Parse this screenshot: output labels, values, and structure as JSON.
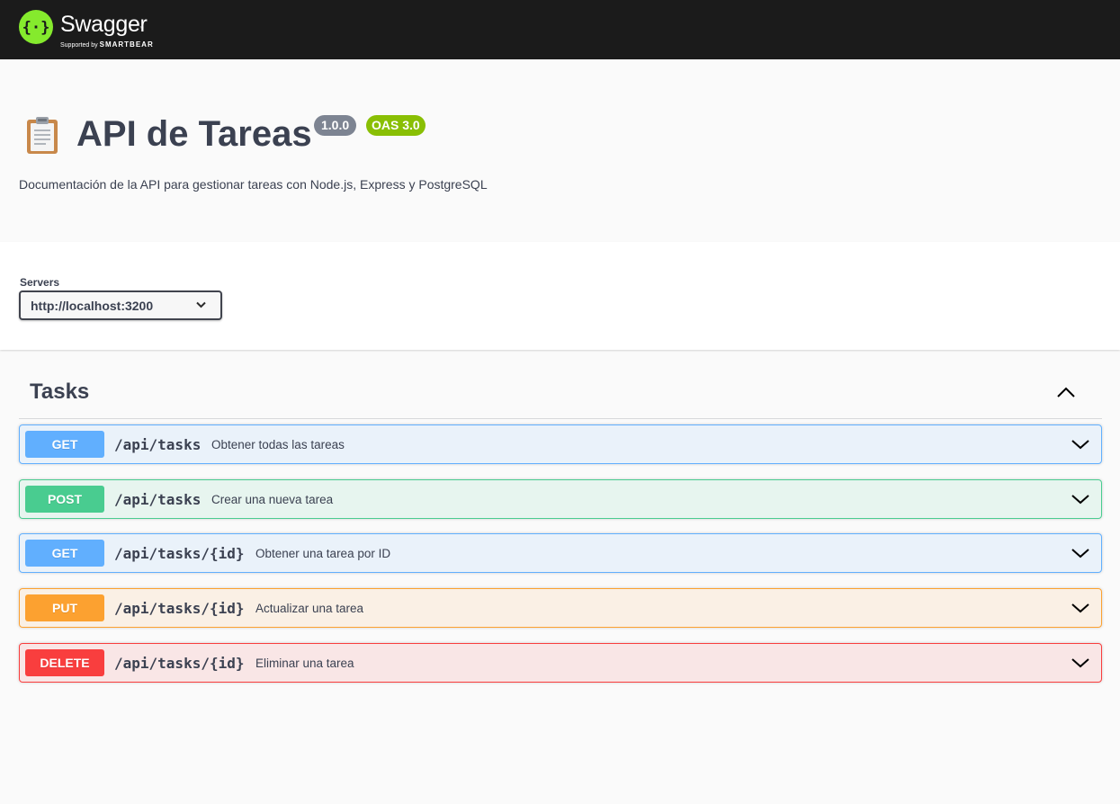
{
  "topbar": {
    "brand_name": "Swagger",
    "brand_tm": "™",
    "supported_prefix": "Supported by",
    "supported_company": "SMARTBEAR",
    "logo_icon": "swagger-braces-icon",
    "colors": {
      "background": "#1b1b1b",
      "logo": "#85ea2d"
    }
  },
  "info": {
    "title_icon": "clipboard-icon",
    "title": "API de Tareas",
    "version": "1.0.0",
    "oas": "OAS 3.0",
    "description": "Documentación de la API para gestionar tareas con Node.js, Express y PostgreSQL"
  },
  "servers": {
    "label": "Servers",
    "selected": "http://localhost:3200"
  },
  "tag": {
    "name": "Tasks",
    "toggle_icon": "chevron-up-icon"
  },
  "operations": [
    {
      "method": "GET",
      "path": "/api/tasks",
      "summary": "Obtener todas las tareas"
    },
    {
      "method": "POST",
      "path": "/api/tasks",
      "summary": "Crear una nueva tarea"
    },
    {
      "method": "GET",
      "path": "/api/tasks/{id}",
      "summary": "Obtener una tarea por ID"
    },
    {
      "method": "PUT",
      "path": "/api/tasks/{id}",
      "summary": "Actualizar una tarea"
    },
    {
      "method": "DELETE",
      "path": "/api/tasks/{id}",
      "summary": "Eliminar una tarea"
    }
  ],
  "method_colors": {
    "GET": "#61affe",
    "POST": "#49cc90",
    "PUT": "#fca130",
    "DELETE": "#f93e3e"
  }
}
